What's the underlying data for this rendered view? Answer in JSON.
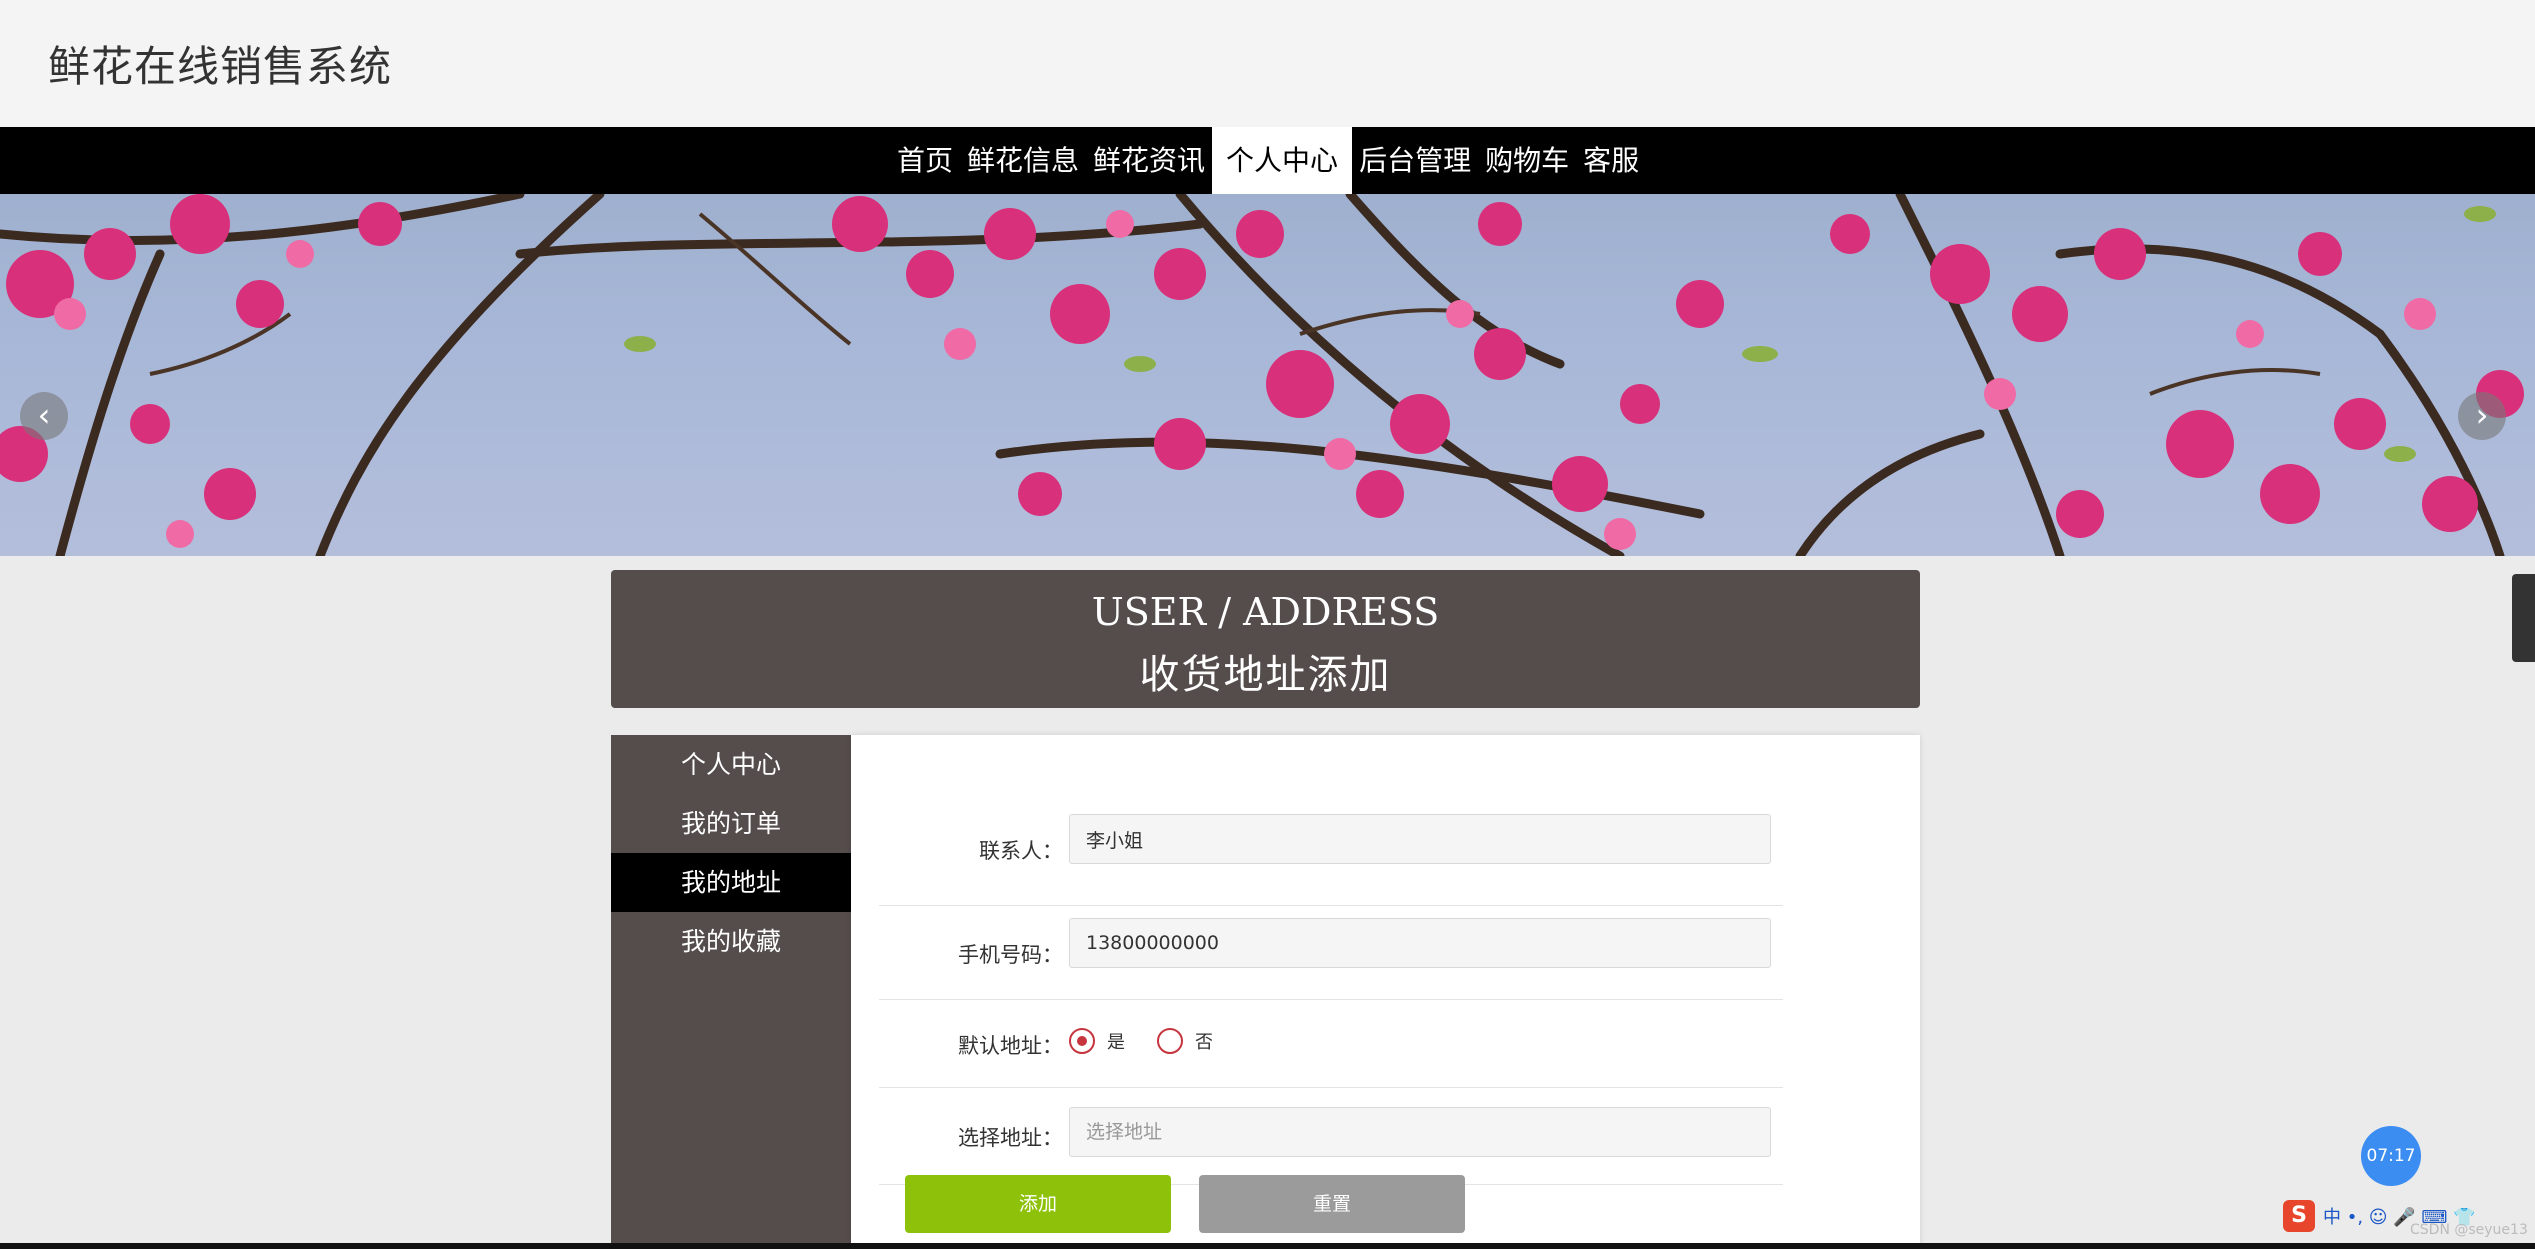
{
  "header": {
    "site_title": "鲜花在线销售系统"
  },
  "nav": {
    "items": [
      {
        "label": "首页"
      },
      {
        "label": "鲜花信息"
      },
      {
        "label": "鲜花资讯"
      },
      {
        "label": "个人中心",
        "active": true
      },
      {
        "label": "后台管理"
      },
      {
        "label": "购物车"
      },
      {
        "label": "客服"
      }
    ]
  },
  "banner": {
    "prev_icon": "‹",
    "next_icon": "›",
    "slide_count": 2,
    "active_slide": 1
  },
  "title_box": {
    "en": "USER / ADDRESS",
    "zh": "收货地址添加"
  },
  "sidebar": {
    "items": [
      {
        "label": "个人中心"
      },
      {
        "label": "我的订单"
      },
      {
        "label": "我的地址",
        "active": true
      },
      {
        "label": "我的收藏"
      }
    ]
  },
  "form": {
    "contact_label": "联系人：",
    "contact_value": "李小姐",
    "phone_label": "手机号码：",
    "phone_value": "13800000000",
    "default_label": "默认地址：",
    "radio_yes": "是",
    "radio_no": "否",
    "address_label": "选择地址：",
    "address_placeholder": "选择地址",
    "add_button": "添加",
    "reset_button": "重置"
  },
  "overlay": {
    "timer": "07:17",
    "ime_text": "中 •, ☺ 🎤 ⌨ 👕",
    "watermark": "CSDN @seyue13"
  },
  "colors": {
    "accent_green": "#8dc10a",
    "panel_brown": "#554c4c",
    "radio_red": "#c7353f"
  }
}
